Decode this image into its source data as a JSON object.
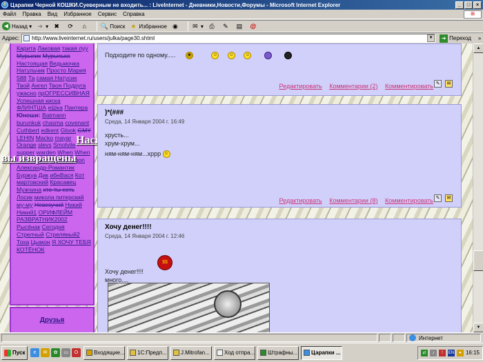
{
  "window": {
    "title": "Царапки Черной КОШКИ.Суеверным не входить... : LiveInternet - Дневники,Новости,Форумы - Microsoft Internet Explorer"
  },
  "menu": [
    "Файл",
    "Правка",
    "Вид",
    "Избранное",
    "Сервис",
    "Справка"
  ],
  "toolbar": {
    "back": "Назад",
    "search": "Поиск",
    "favorites": "Избранное"
  },
  "address": {
    "label": "Адрес:",
    "url": "http://www.liveinternet.ru/users/julka/page30.shtml",
    "go": "Переход",
    "links": "»"
  },
  "sidebar": {
    "items": [
      {
        "t": "Карита",
        "s": false
      },
      {
        "t": "Лаковая",
        "s": false
      },
      {
        "t": "такая луу",
        "s": false
      },
      {
        "t": "Мурысик",
        "s": true
      },
      {
        "t": "Мурыська",
        "s": true
      },
      {
        "t": "Настоящая",
        "s": false
      },
      {
        "t": "Ведьмочка",
        "s": false
      },
      {
        "t": "Натульчик",
        "s": false
      },
      {
        "t": "Просто Мария 588",
        "s": false
      },
      {
        "t": "Та",
        "s": false
      },
      {
        "t": "самая Натусик",
        "s": false
      },
      {
        "t": "Твой",
        "s": false
      },
      {
        "t": "Ангел",
        "s": false
      },
      {
        "t": "Твоя Подруга",
        "s": false
      },
      {
        "t": "ужасно",
        "s": false
      },
      {
        "t": "прОГРЕССИВНАЯ",
        "s": false
      },
      {
        "t": "Успешная киска",
        "s": false
      },
      {
        "t": "ФЛИНТША",
        "s": false
      },
      {
        "t": "еШка",
        "s": false
      },
      {
        "t": "Пантера",
        "s": false
      }
    ],
    "heading": "Юноши:",
    "items2": [
      {
        "t": "Batmann",
        "s": false
      },
      {
        "t": "burunkuk",
        "s": false
      },
      {
        "t": "chasma",
        "s": false
      },
      {
        "t": "covenant",
        "s": false
      },
      {
        "t": "Cuthbert",
        "s": false
      },
      {
        "t": "edkent",
        "s": false
      },
      {
        "t": "Glook",
        "s": false
      },
      {
        "t": "GMY",
        "s": true
      },
      {
        "t": "LEHIN",
        "s": false
      },
      {
        "t": "Macko",
        "s": false
      },
      {
        "t": "mayar",
        "s": false
      },
      {
        "t": "Orange",
        "s": false
      },
      {
        "t": "slevs",
        "s": false
      },
      {
        "t": "Smolvile",
        "s": false
      },
      {
        "t": "supper",
        "s": false
      },
      {
        "t": "warden",
        "s": false
      },
      {
        "t": "When",
        "s": false
      },
      {
        "t": "When I come back",
        "s": false
      },
      {
        "t": "WhiteDragon",
        "s": false
      },
      {
        "t": "Александр-Романтик",
        "s": false
      },
      {
        "t": "Буржуа",
        "s": false
      },
      {
        "t": "Дик",
        "s": false
      },
      {
        "t": "ибнВася",
        "s": false
      },
      {
        "t": "Кот мартовский",
        "s": false
      },
      {
        "t": "Красавец Мужчина",
        "s": false
      },
      {
        "t": "кто-ты есть",
        "s": true
      },
      {
        "t": "Лосик",
        "s": false
      },
      {
        "t": "микола питерский",
        "s": false
      },
      {
        "t": "му-му",
        "s": false
      },
      {
        "t": "Невезучий",
        "s": true
      },
      {
        "t": "Никий",
        "s": false
      },
      {
        "t": "Никий1",
        "s": false
      },
      {
        "t": "ОРИФЛЕЙМ",
        "s": false
      },
      {
        "t": "РАЗВРАТНИК2002",
        "s": false
      },
      {
        "t": "Рысёнак",
        "s": false
      },
      {
        "t": "Сегодня",
        "s": false
      },
      {
        "t": "Стрелчый",
        "s": false
      },
      {
        "t": "Стреляный2",
        "s": false
      },
      {
        "t": "Тоха",
        "s": false
      },
      {
        "t": "Цымон",
        "s": false
      },
      {
        "t": "Я ХОЧУ ТЕБЯ",
        "s": false
      },
      {
        "t": "КОТЁНОК",
        "s": false
      }
    ],
    "friends": "Друзья"
  },
  "overlay": {
    "line1": "Насколько",
    "line2": "вы извращены"
  },
  "posts": [
    {
      "title": "",
      "date": "",
      "text": "Подходите по одному.....",
      "actions": [
        "Редактировать",
        "Комментарии (2)",
        "Комментировать"
      ]
    },
    {
      "title": ")*(###",
      "date": "Среда, 14 Января 2004 г. 16:49",
      "text": [
        "хрусть...",
        "хрум-хрум...",
        "ням-ням-ням...хррр"
      ],
      "actions": [
        "Редактировать",
        "Комментарии (8)",
        "Комментировать"
      ]
    },
    {
      "title": "Хочу денег!!!!",
      "date": "Среда, 14 Января 2004 г. 12:46",
      "text": [
        "Хочу денег!!!!",
        "много...."
      ]
    }
  ],
  "status": {
    "zone": "Интернет"
  },
  "taskbar": {
    "start": "Пуск",
    "tasks": [
      "Входящие...",
      "1С:Предп...",
      "J.Mitrofan...",
      "Ход отпра...",
      "Штрафны...",
      "Царапки ..."
    ],
    "lang": "EN",
    "clock": "16:15"
  },
  "colors": {
    "sidebar": "#cc66ee",
    "post": "#d0d0fa",
    "links": "#cc3377"
  }
}
